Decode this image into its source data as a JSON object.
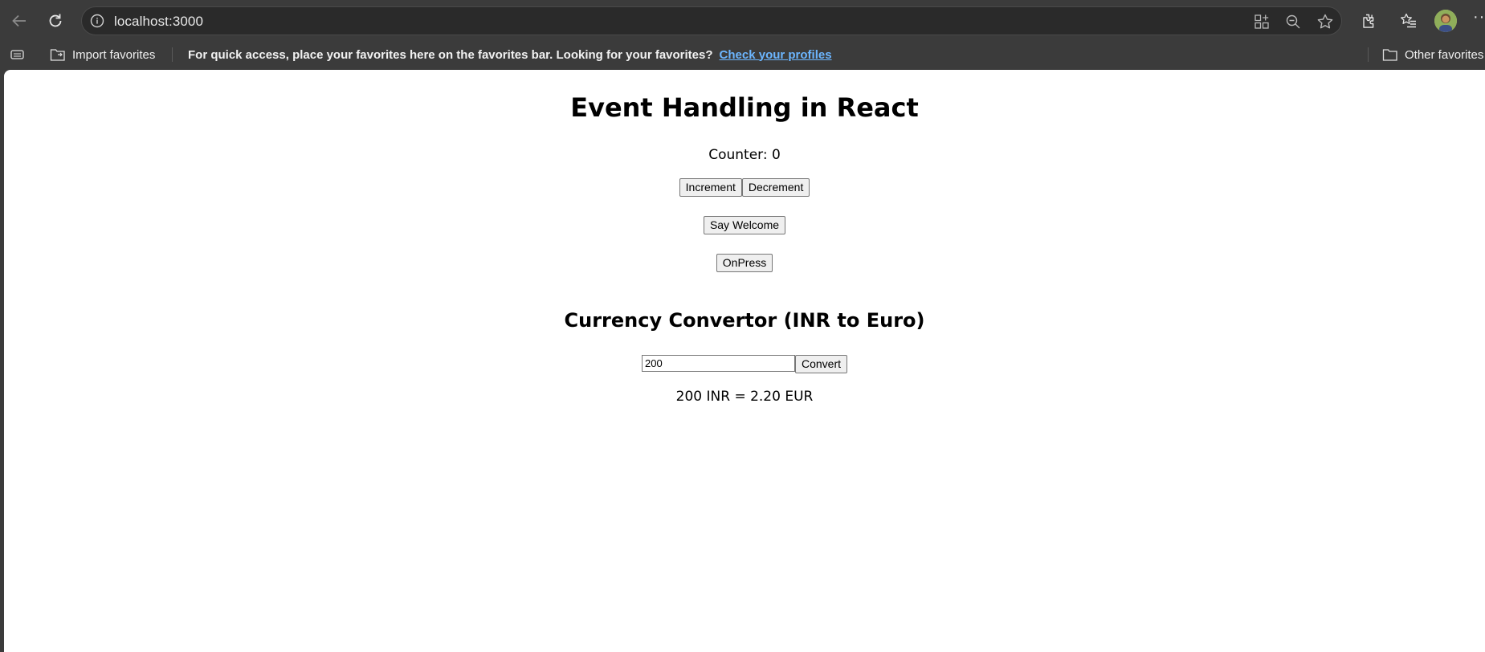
{
  "browser": {
    "url": "localhost:3000",
    "favorites_bar": {
      "import_label": "Import favorites",
      "message": "For quick access, place your favorites here on the favorites bar. Looking for your favorites?",
      "link_label": "Check your profiles",
      "other_label": "Other favorites"
    },
    "icons": [
      "back-icon",
      "refresh-icon",
      "info-icon",
      "apps-icon",
      "zoom-out-icon",
      "favorite-star-icon",
      "extensions-icon",
      "favorites-icon",
      "avatar",
      "more-icon"
    ],
    "more_label": "···"
  },
  "page": {
    "title": "Event Handling in React",
    "counter_label": "Counter: 0",
    "increment_label": "Increment",
    "decrement_label": "Decrement",
    "welcome_label": "Say Welcome",
    "onpress_label": "OnPress",
    "converter": {
      "title": "Currency Convertor (INR to Euro)",
      "input_value": "200",
      "convert_label": "Convert",
      "result": "200 INR = 2.20 EUR"
    }
  },
  "colors": {
    "chrome_bg": "#3b3b3b",
    "address_bg": "#2a2a2a",
    "link": "#6cb6ff",
    "page_bg": "#ffffff"
  }
}
